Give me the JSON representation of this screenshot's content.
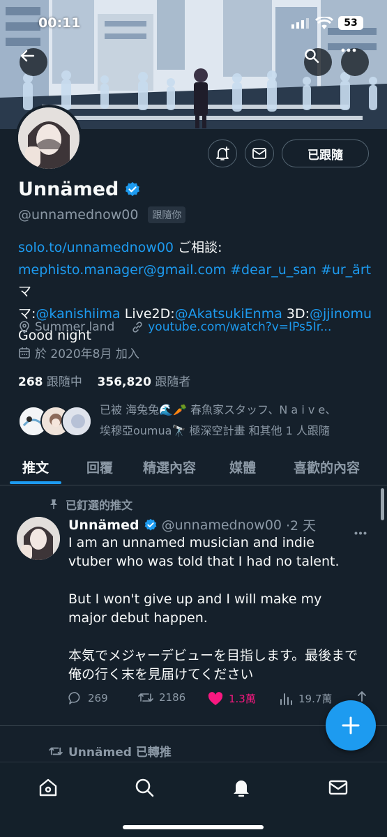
{
  "status_bar": {
    "time": "00:11",
    "battery": "53"
  },
  "profile": {
    "display_name": "Unnämed",
    "handle": "@unnamednow00",
    "follows_you_badge": "跟隨你",
    "following_button": "已跟隨",
    "bio": {
      "link1": "solo.to/unnamednow00",
      "text1": " ご相談:",
      "email": "mephisto.manager@gmail.com",
      "tag1": "#dear_u_san",
      "tag2": "#ur_ärt",
      "text2": " マ",
      "text3": "マ:",
      "mention1": "@kanishiima",
      "text4": " Live2D:",
      "mention2": "@AkatsukiEnma",
      "text5": " 3D:",
      "mention3": "@jjinomu",
      "text6": "Good night"
    },
    "location": "Summer land",
    "website": "youtube.com/watch?v=IPs5Ir...",
    "joined": "於 2020年8月 加入",
    "following_count": "268",
    "following_label": "跟隨中",
    "followers_count": "356,820",
    "followers_label": "跟隨者",
    "followed_by_line1": "已被 海兔兔🌊🥕 春魚家スタッフ、N a i v e、",
    "followed_by_line2": "埃穆亞oumua🔭 極深空計畫 和其他 1 人跟隨"
  },
  "tabs": [
    {
      "label": "推文"
    },
    {
      "label": "回覆"
    },
    {
      "label": "精選內容"
    },
    {
      "label": "媒體"
    },
    {
      "label": "喜歡的內容"
    }
  ],
  "pinned_tweet": {
    "pinned_label": "已釘選的推文",
    "author_name": "Unnämed",
    "author_handle": "@unnamednow00",
    "time": "·2 天",
    "text": "I am an unnamed musician and indie vtuber who was told that I had no talent.\n\nBut I won't give up and I will make my major debut happen.\n\n本気でメジャーデビューを目指します。最後まで俺の行く末を見届けてください",
    "replies": "269",
    "retweets": "2186",
    "likes": "1.3萬",
    "views": "19.7萬"
  },
  "next_item": {
    "retweeted_label": "Unnämed 已轉推"
  },
  "colors": {
    "background": "#15202b",
    "accent": "#1d9bf0",
    "like": "#f91880",
    "muted": "#8b98a5"
  }
}
